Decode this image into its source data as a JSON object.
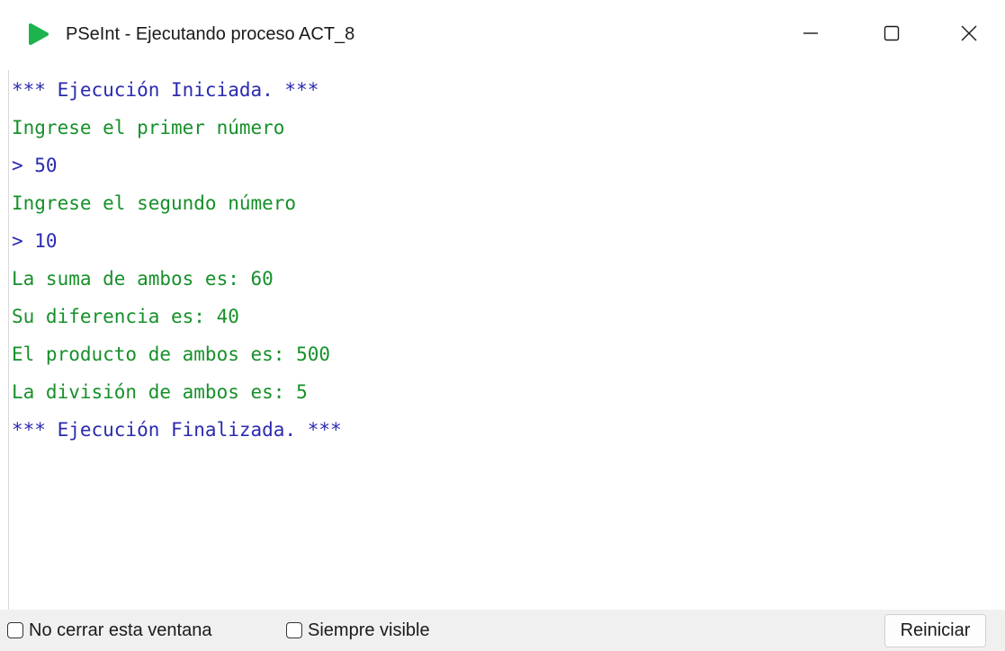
{
  "window": {
    "title": "PSeInt - Ejecutando proceso ACT_8",
    "icon": "pseint-app-icon",
    "controls": {
      "minimize_icon": "minimize-icon",
      "maximize_icon": "maximize-icon",
      "close_icon": "close-icon"
    }
  },
  "console": {
    "lines": [
      {
        "text": "*** Ejecución Iniciada. ***",
        "kind": "system"
      },
      {
        "text": "Ingrese el primer número",
        "kind": "output"
      },
      {
        "text": "> 50",
        "kind": "input"
      },
      {
        "text": "Ingrese el segundo número",
        "kind": "output"
      },
      {
        "text": "> 10",
        "kind": "input"
      },
      {
        "text": "La suma de ambos es: 60",
        "kind": "output"
      },
      {
        "text": "Su diferencia es: 40",
        "kind": "output"
      },
      {
        "text": "El producto de ambos es: 500",
        "kind": "output"
      },
      {
        "text": "La división de ambos es: 5",
        "kind": "output"
      },
      {
        "text": "*** Ejecución Finalizada. ***",
        "kind": "system"
      }
    ]
  },
  "bottombar": {
    "keep_open_label": "No cerrar esta ventana",
    "keep_open_checked": false,
    "always_visible_label": "Siempre visible",
    "always_visible_checked": false,
    "reset_label": "Reiniciar"
  },
  "colors": {
    "output_text": "#16902a",
    "system_text": "#2a2ab0",
    "icon_green": "#1db34f"
  }
}
